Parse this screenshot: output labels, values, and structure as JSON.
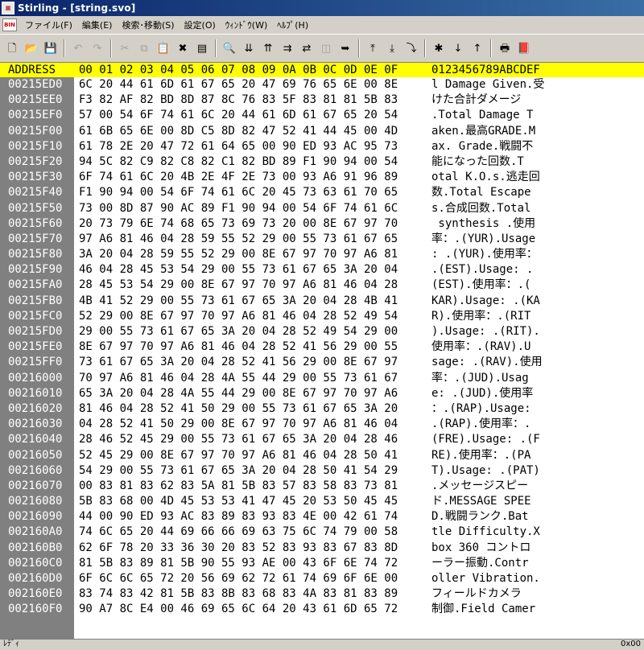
{
  "window": {
    "title": "Stirling - [string.svo]",
    "icon_name": "stirling-app-icon"
  },
  "menu": {
    "logo_text": "BIN",
    "items": [
      "ファイル(F)",
      "編集(E)",
      "検索･移動(S)",
      "設定(O)",
      "ｳｨﾝﾄﾞｳ(W)",
      "ﾍﾙﾌﾟ(H)"
    ]
  },
  "toolbar": {
    "buttons": [
      {
        "icon": "new-file-icon",
        "glyph": "🗋",
        "enabled": true
      },
      {
        "icon": "open-folder-icon",
        "glyph": "📂",
        "enabled": true
      },
      {
        "icon": "save-icon",
        "glyph": "💾",
        "enabled": true
      },
      {
        "sep": true
      },
      {
        "icon": "undo-icon",
        "glyph": "↶",
        "enabled": false
      },
      {
        "icon": "redo-icon",
        "glyph": "↷",
        "enabled": false
      },
      {
        "sep": true
      },
      {
        "icon": "cut-icon",
        "glyph": "✂",
        "enabled": false
      },
      {
        "icon": "copy-icon",
        "glyph": "⧉",
        "enabled": false
      },
      {
        "icon": "paste-icon",
        "glyph": "📋",
        "enabled": true
      },
      {
        "icon": "delete-icon",
        "glyph": "✖",
        "enabled": true
      },
      {
        "icon": "insert-icon",
        "glyph": "▤",
        "enabled": true
      },
      {
        "sep": true
      },
      {
        "icon": "find-icon",
        "glyph": "🔍",
        "enabled": true
      },
      {
        "icon": "find-down-icon",
        "glyph": "⇊",
        "enabled": true
      },
      {
        "icon": "find-prev-icon",
        "glyph": "⇈",
        "enabled": true
      },
      {
        "icon": "find-next-icon",
        "glyph": "⇉",
        "enabled": true
      },
      {
        "icon": "replace-icon",
        "glyph": "⇄",
        "enabled": true
      },
      {
        "icon": "compare-icon",
        "glyph": "◫",
        "enabled": false
      },
      {
        "icon": "goto-icon",
        "glyph": "➥",
        "enabled": true
      },
      {
        "sep": true
      },
      {
        "icon": "jump-top-icon",
        "glyph": "⤒",
        "enabled": true
      },
      {
        "icon": "jump-bottom-icon",
        "glyph": "⤓",
        "enabled": true
      },
      {
        "icon": "jump-address-icon",
        "glyph": "⤵",
        "enabled": true
      },
      {
        "sep": true
      },
      {
        "icon": "mark-icon",
        "glyph": "✱",
        "enabled": true
      },
      {
        "icon": "mark-next-icon",
        "glyph": "↓",
        "enabled": true
      },
      {
        "icon": "mark-prev-icon",
        "glyph": "↑",
        "enabled": true
      },
      {
        "sep": true
      },
      {
        "icon": "print-icon",
        "glyph": "🖶",
        "enabled": true
      },
      {
        "icon": "help-book-icon",
        "glyph": "📕",
        "enabled": true
      }
    ]
  },
  "hex": {
    "header": {
      "address": "ADDRESS",
      "columns": "00 01 02 03 04 05 06 07 08 09 0A 0B 0C 0D 0E 0F",
      "text": "0123456789ABCDEF"
    },
    "rows": [
      {
        "addr": "00215ED0",
        "bytes": "6C 20 44 61 6D 61 67 65 20 47 69 76 65 6E 00 8E",
        "text": "l Damage Given.受"
      },
      {
        "addr": "00215EE0",
        "bytes": "F3 82 AF 82 BD 8D 87 8C 76 83 5F 83 81 81 5B 83",
        "text": "けた合計ダメージ"
      },
      {
        "addr": "00215EF0",
        "bytes": "57 00 54 6F 74 61 6C 20 44 61 6D 61 67 65 20 54",
        "text": ".Total Damage T"
      },
      {
        "addr": "00215F00",
        "bytes": "61 6B 65 6E 00 8D C5 8D 82 47 52 41 44 45 00 4D",
        "text": "aken.最高GRADE.M"
      },
      {
        "addr": "00215F10",
        "bytes": "61 78 2E 20 47 72 61 64 65 00 90 ED 93 AC 95 73",
        "text": "ax. Grade.戦闘不"
      },
      {
        "addr": "00215F20",
        "bytes": "94 5C 82 C9 82 C8 82 C1 82 BD 89 F1 90 94 00 54",
        "text": "能になった回数.T"
      },
      {
        "addr": "00215F30",
        "bytes": "6F 74 61 6C 20 4B 2E 4F 2E 73 00 93 A6 91 96 89",
        "text": "otal K.O.s.逃走回"
      },
      {
        "addr": "00215F40",
        "bytes": "F1 90 94 00 54 6F 74 61 6C 20 45 73 63 61 70 65",
        "text": "数.Total Escape"
      },
      {
        "addr": "00215F50",
        "bytes": "73 00 8D 87 90 AC 89 F1 90 94 00 54 6F 74 61 6C",
        "text": "s.合成回数.Total"
      },
      {
        "addr": "00215F60",
        "bytes": "20 73 79 6E 74 68 65 73 69 73 20 00 8E 67 97 70",
        "text": " synthesis .使用"
      },
      {
        "addr": "00215F70",
        "bytes": "97 A6 81 46 04 28 59 55 52 29 00 55 73 61 67 65",
        "text": "率：.(YUR).Usage"
      },
      {
        "addr": "00215F80",
        "bytes": "3A 20 04 28 59 55 52 29 00 8E 67 97 70 97 A6 81",
        "text": ": .(YUR).使用率："
      },
      {
        "addr": "00215F90",
        "bytes": "46 04 28 45 53 54 29 00 55 73 61 67 65 3A 20 04",
        "text": ".(EST).Usage: ."
      },
      {
        "addr": "00215FA0",
        "bytes": "28 45 53 54 29 00 8E 67 97 70 97 A6 81 46 04 28",
        "text": "(EST).使用率：.("
      },
      {
        "addr": "00215FB0",
        "bytes": "4B 41 52 29 00 55 73 61 67 65 3A 20 04 28 4B 41",
        "text": "KAR).Usage: .(KA"
      },
      {
        "addr": "00215FC0",
        "bytes": "52 29 00 8E 67 97 70 97 A6 81 46 04 28 52 49 54",
        "text": "R).使用率：.(RIT"
      },
      {
        "addr": "00215FD0",
        "bytes": "29 00 55 73 61 67 65 3A 20 04 28 52 49 54 29 00",
        "text": ").Usage: .(RIT)."
      },
      {
        "addr": "00215FE0",
        "bytes": "8E 67 97 70 97 A6 81 46 04 28 52 41 56 29 00 55",
        "text": "使用率：.(RAV).U"
      },
      {
        "addr": "00215FF0",
        "bytes": "73 61 67 65 3A 20 04 28 52 41 56 29 00 8E 67 97",
        "text": "sage: .(RAV).使用"
      },
      {
        "addr": "00216000",
        "bytes": "70 97 A6 81 46 04 28 4A 55 44 29 00 55 73 61 67",
        "text": "率：.(JUD).Usag"
      },
      {
        "addr": "00216010",
        "bytes": "65 3A 20 04 28 4A 55 44 29 00 8E 67 97 70 97 A6",
        "text": "e: .(JUD).使用率"
      },
      {
        "addr": "00216020",
        "bytes": "81 46 04 28 52 41 50 29 00 55 73 61 67 65 3A 20",
        "text": "：.(RAP).Usage:"
      },
      {
        "addr": "00216030",
        "bytes": "04 28 52 41 50 29 00 8E 67 97 70 97 A6 81 46 04",
        "text": ".(RAP).使用率：."
      },
      {
        "addr": "00216040",
        "bytes": "28 46 52 45 29 00 55 73 61 67 65 3A 20 04 28 46",
        "text": "(FRE).Usage: .(F"
      },
      {
        "addr": "00216050",
        "bytes": "52 45 29 00 8E 67 97 70 97 A6 81 46 04 28 50 41",
        "text": "RE).使用率：.(PA"
      },
      {
        "addr": "00216060",
        "bytes": "54 29 00 55 73 61 67 65 3A 20 04 28 50 41 54 29",
        "text": "T).Usage: .(PAT)"
      },
      {
        "addr": "00216070",
        "bytes": "00 83 81 83 62 83 5A 81 5B 83 57 83 58 83 73 81",
        "text": ".メッセージスピー"
      },
      {
        "addr": "00216080",
        "bytes": "5B 83 68 00 4D 45 53 53 41 47 45 20 53 50 45 45",
        "text": "ド.MESSAGE SPEE"
      },
      {
        "addr": "00216090",
        "bytes": "44 00 90 ED 93 AC 83 89 83 93 83 4E 00 42 61 74",
        "text": "D.戦闘ランク.Bat"
      },
      {
        "addr": "002160A0",
        "bytes": "74 6C 65 20 44 69 66 66 69 63 75 6C 74 79 00 58",
        "text": "tle Difficulty.X"
      },
      {
        "addr": "002160B0",
        "bytes": "62 6F 78 20 33 36 30 20 83 52 83 93 83 67 83 8D",
        "text": "box 360 コントロ"
      },
      {
        "addr": "002160C0",
        "bytes": "81 5B 83 89 81 5B 90 55 93 AE 00 43 6F 6E 74 72",
        "text": "ーラー振動.Contr"
      },
      {
        "addr": "002160D0",
        "bytes": "6F 6C 6C 65 72 20 56 69 62 72 61 74 69 6F 6E 00",
        "text": "oller Vibration."
      },
      {
        "addr": "002160E0",
        "bytes": "83 74 83 42 81 5B 83 8B 83 68 83 4A 83 81 83 89",
        "text": "フィールドカメラ"
      },
      {
        "addr": "002160F0",
        "bytes": "90 A7 8C E4 00 46 69 65 6C 64 20 43 61 6D 65 72",
        "text": "制御.Field Camer"
      }
    ]
  },
  "status": {
    "left": "ﾚﾃﾞｨ",
    "right": "0x00"
  },
  "colors": {
    "title_start": "#0a246a",
    "header_highlight": "#ffff00",
    "address_bg": "#808080"
  }
}
